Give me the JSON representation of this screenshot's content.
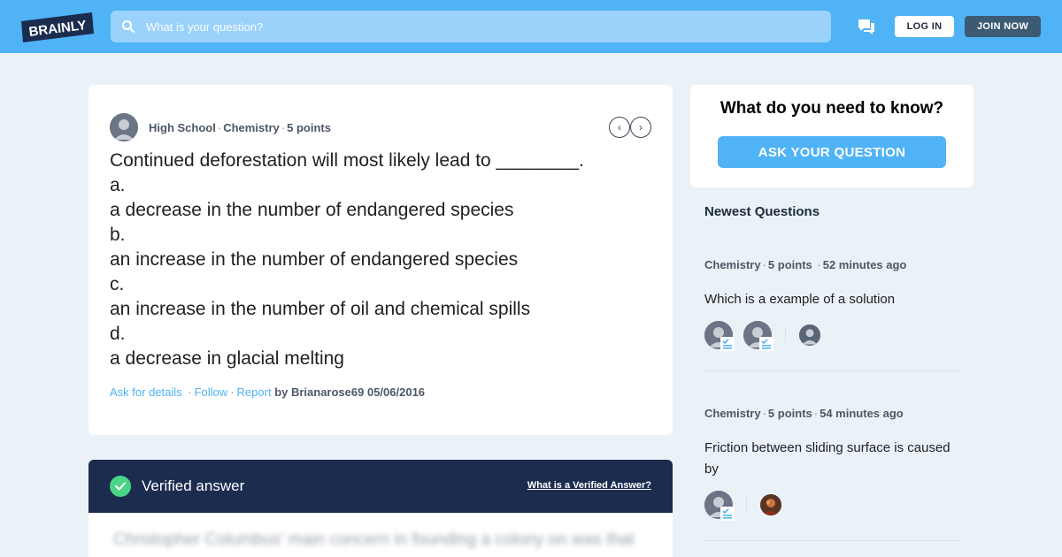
{
  "header": {
    "logo_text": "BRAINLY",
    "search_placeholder": "What is your question?",
    "login_label": "LOG IN",
    "join_label": "JOIN NOW"
  },
  "question": {
    "level": "High School",
    "subject": "Chemistry",
    "points": "5 points",
    "lines": [
      "Continued deforestation will most likely lead to ________.",
      "a.",
      "a decrease in the number of endangered species",
      "b.",
      "an increase in the number of endangered species",
      "c.",
      "an increase in the number of oil and chemical spills",
      "d.",
      "a decrease in glacial melting"
    ],
    "ask_details": "Ask for details",
    "follow": "Follow",
    "report": "Report",
    "byline": "by Brianarose69 05/06/2016"
  },
  "verified": {
    "title": "Verified answer",
    "link": "What is a Verified Answer?",
    "blurred_text": "Christopher Columbus' main concern in founding a colony on was that"
  },
  "sidebar": {
    "ask_heading": "What do you need to know?",
    "ask_button": "ASK YOUR QUESTION",
    "newest_heading": "Newest Questions",
    "questions": [
      {
        "subject": "Chemistry",
        "points": "5 points",
        "time": "52 minutes ago",
        "text": "Which is a example of a solution"
      },
      {
        "subject": "Chemistry",
        "points": "5 points",
        "time": "54 minutes ago",
        "text": "Friction between sliding surface is caused by"
      }
    ]
  },
  "colors": {
    "brand_blue": "#4fb3f6",
    "navy": "#1b2c4f",
    "verified_green": "#4ad486",
    "page_bg": "#ebf2f7"
  }
}
